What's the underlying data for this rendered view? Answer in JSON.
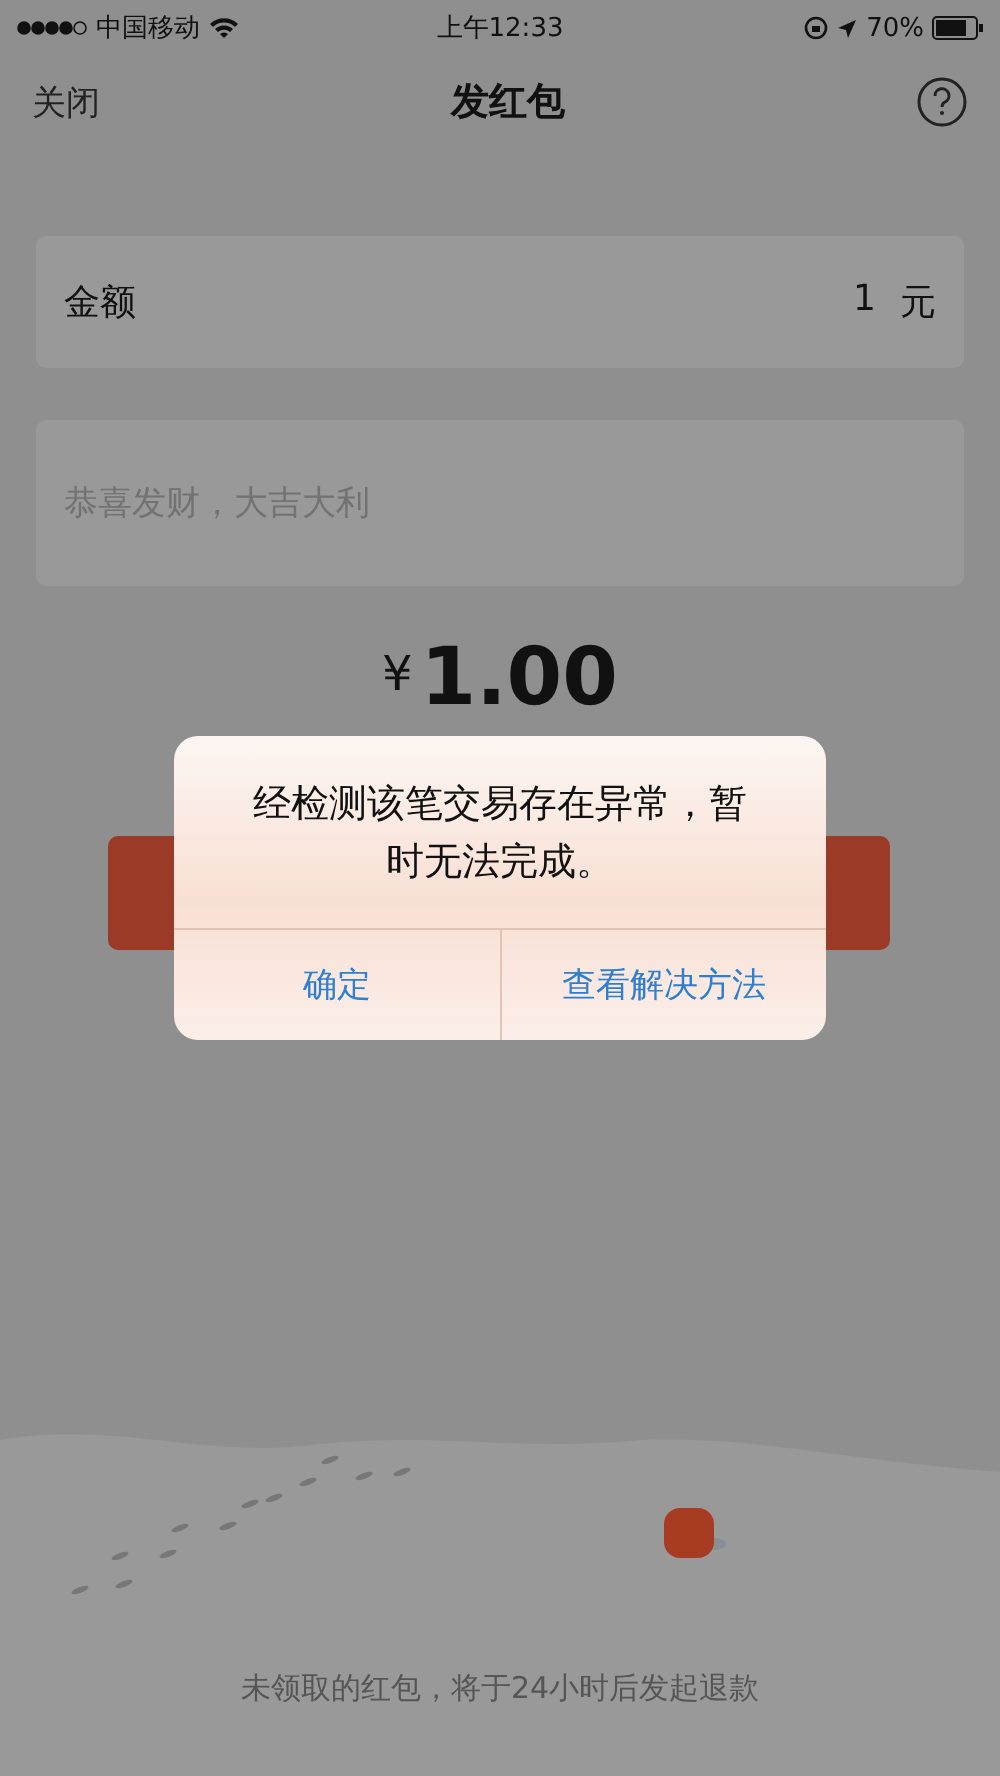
{
  "status_bar": {
    "carrier": "中国移动",
    "time": "上午12:33",
    "battery": "70%"
  },
  "nav": {
    "close": "关闭",
    "title": "发红包"
  },
  "amount_field": {
    "label": "金额",
    "value": "1",
    "unit": "元"
  },
  "message_field": {
    "placeholder": "恭喜发财，大吉大利"
  },
  "total": {
    "currency": "¥",
    "amount": "1.00"
  },
  "dialog": {
    "message": "经检测该笔交易存在异常，暂时无法完成。",
    "buttons": [
      "确定",
      "查看解决方法"
    ]
  },
  "footer": {
    "note": "未领取的红包，将于24小时后发起退款"
  }
}
